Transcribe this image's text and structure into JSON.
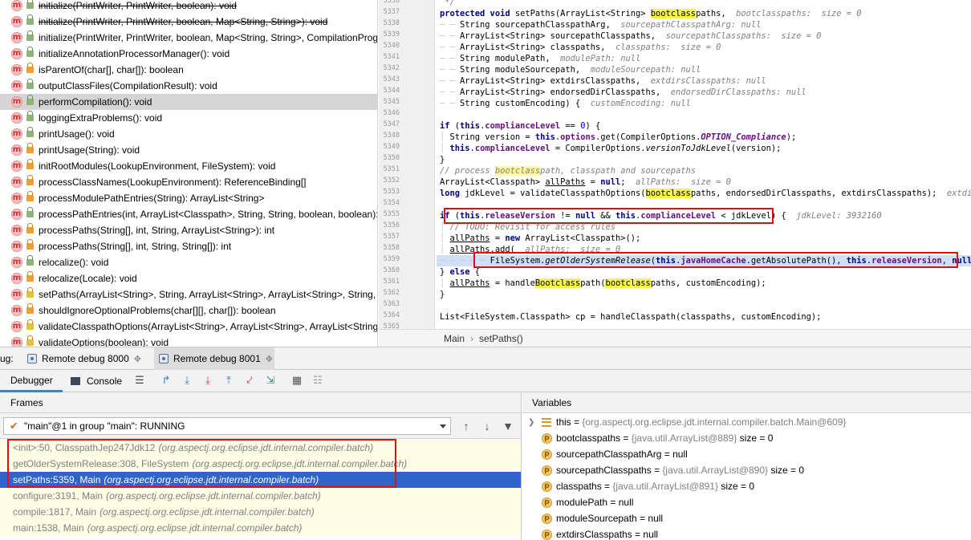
{
  "structure": {
    "items": [
      {
        "label": "initialize(PrintWriter, PrintWriter, boolean): void",
        "icon": "method-icon",
        "access": "public",
        "deprecated": true
      },
      {
        "label": "initialize(PrintWriter, PrintWriter, boolean, Map<String, String>): void",
        "icon": "method-icon",
        "access": "public",
        "deprecated": true
      },
      {
        "label": "initialize(PrintWriter, PrintWriter, boolean, Map<String, String>, CompilationProg",
        "icon": "method-icon",
        "access": "public",
        "deprecated": false
      },
      {
        "label": "initializeAnnotationProcessorManager(): void",
        "icon": "method-icon",
        "access": "public",
        "deprecated": false
      },
      {
        "label": "isParentOf(char[], char[]): boolean",
        "icon": "method-icon",
        "access": "private",
        "deprecated": false
      },
      {
        "label": "outputClassFiles(CompilationResult): void",
        "icon": "method-icon",
        "access": "public",
        "deprecated": false
      },
      {
        "label": "performCompilation(): void",
        "icon": "method-icon",
        "access": "public",
        "deprecated": false,
        "selected": true
      },
      {
        "label": "loggingExtraProblems(): void",
        "icon": "method-icon",
        "access": "public",
        "deprecated": false
      },
      {
        "label": "printUsage(): void",
        "icon": "method-icon",
        "access": "public",
        "deprecated": false
      },
      {
        "label": "printUsage(String): void",
        "icon": "method-icon",
        "access": "private",
        "deprecated": false
      },
      {
        "label": "initRootModules(LookupEnvironment, FileSystem): void",
        "icon": "method-icon",
        "access": "private",
        "deprecated": false
      },
      {
        "label": "processClassNames(LookupEnvironment): ReferenceBinding[]",
        "icon": "method-icon",
        "access": "private",
        "deprecated": false
      },
      {
        "label": "processModulePathEntries(String): ArrayList<String>",
        "icon": "method-icon",
        "access": "private",
        "deprecated": false
      },
      {
        "label": "processPathEntries(int, ArrayList<Classpath>, String, String, boolean, boolean): v",
        "icon": "method-icon",
        "access": "public",
        "deprecated": false
      },
      {
        "label": "processPaths(String[], int, String, ArrayList<String>): int",
        "icon": "method-icon",
        "access": "private",
        "deprecated": false
      },
      {
        "label": "processPaths(String[], int, String, String[]): int",
        "icon": "method-icon",
        "access": "private",
        "deprecated": false
      },
      {
        "label": "relocalize(): void",
        "icon": "method-icon",
        "access": "public",
        "deprecated": false
      },
      {
        "label": "relocalize(Locale): void",
        "icon": "method-icon",
        "access": "private",
        "deprecated": false
      },
      {
        "label": "setPaths(ArrayList<String>, String, ArrayList<String>, ArrayList<String>, String, S",
        "icon": "method-icon",
        "access": "protected",
        "deprecated": false
      },
      {
        "label": "shouldIgnoreOptionalProblems(char[][], char[]): boolean",
        "icon": "method-icon",
        "access": "private",
        "deprecated": false
      },
      {
        "label": "validateClasspathOptions(ArrayList<String>, ArrayList<String>, ArrayList<String>",
        "icon": "method-icon",
        "access": "protected",
        "deprecated": false
      },
      {
        "label": "validateOptions(boolean): void",
        "icon": "method-icon",
        "access": "protected",
        "deprecated": false
      }
    ]
  },
  "editor": {
    "line_numbers": [
      "5336",
      "5337",
      "5338",
      "5339",
      "5340",
      "5341",
      "5342",
      "5343",
      "5344",
      "5345",
      "5346",
      "5347",
      "5348",
      "5349",
      "5350",
      "5351",
      "5352",
      "5353",
      "5354",
      "5355",
      "5356",
      "5357",
      "5358",
      "5359",
      "5360",
      "5361",
      "5362",
      "5363",
      "5364",
      "5365"
    ],
    "breadcrumb": {
      "class_name": "Main",
      "separator": "›",
      "method_name": "setPaths()"
    }
  },
  "debug": {
    "tabs": [
      {
        "label": "Remote debug 8000",
        "prefix": "ug:"
      },
      {
        "label": "Remote debug 8001",
        "active": true
      }
    ],
    "toolbar": {
      "debugger_label": "Debugger",
      "console_label": "Console"
    },
    "frames": {
      "title": "Frames",
      "thread": "\"main\"@1 in group \"main\": RUNNING",
      "items": [
        {
          "method": "<init>:50, ClasspathJep247Jdk12",
          "pkg": "(org.aspectj.org.eclipse.jdt.internal.compiler.batch)"
        },
        {
          "method": "getOlderSystemRelease:308, FileSystem",
          "pkg": "(org.aspectj.org.eclipse.jdt.internal.compiler.batch)"
        },
        {
          "method": "setPaths:5359, Main",
          "pkg": "(org.aspectj.org.eclipse.jdt.internal.compiler.batch)",
          "selected": true
        },
        {
          "method": "configure:3191, Main",
          "pkg": "(org.aspectj.org.eclipse.jdt.internal.compiler.batch)"
        },
        {
          "method": "compile:1817, Main",
          "pkg": "(org.aspectj.org.eclipse.jdt.internal.compiler.batch)"
        },
        {
          "method": "main:1538, Main",
          "pkg": "(org.aspectj.org.eclipse.jdt.internal.compiler.batch)"
        }
      ]
    },
    "variables": {
      "title": "Variables",
      "items": [
        {
          "name": "this",
          "eq": " = ",
          "value": "{org.aspectj.org.eclipse.jdt.internal.compiler.batch.Main@609}",
          "extra": "",
          "icon": "list-icon",
          "expandable": true
        },
        {
          "name": "bootclasspaths",
          "eq": " = ",
          "value": "{java.util.ArrayList@889}",
          "extra": "  size = 0",
          "icon": "param-icon"
        },
        {
          "name": "sourcepathClasspathArg",
          "eq": " = ",
          "value": "",
          "extra": "null",
          "icon": "param-icon"
        },
        {
          "name": "sourcepathClasspaths",
          "eq": " = ",
          "value": "{java.util.ArrayList@890}",
          "extra": "  size = 0",
          "icon": "param-icon"
        },
        {
          "name": "classpaths",
          "eq": " = ",
          "value": "{java.util.ArrayList@891}",
          "extra": "  size = 0",
          "icon": "param-icon"
        },
        {
          "name": "modulePath",
          "eq": " = ",
          "value": "",
          "extra": "null",
          "icon": "param-icon"
        },
        {
          "name": "moduleSourcepath",
          "eq": " = ",
          "value": "",
          "extra": "null",
          "icon": "param-icon"
        },
        {
          "name": "extdirsClasspaths",
          "eq": " = ",
          "value": "",
          "extra": "null",
          "icon": "param-icon"
        }
      ]
    }
  },
  "colors": {
    "selection_blue": "#2f65ca",
    "highlight_red": "#e01010",
    "search_highlight": "#f5f54a",
    "exec_line": "#cfdff5"
  }
}
